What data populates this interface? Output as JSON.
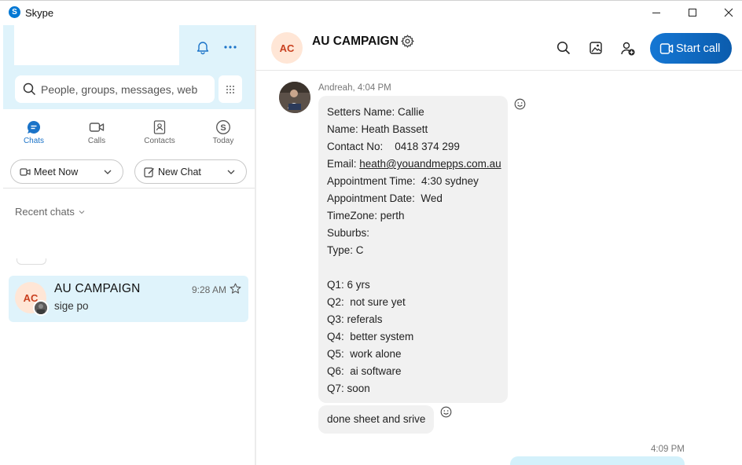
{
  "window": {
    "title": "Skype",
    "logo_letter": "S",
    "minimize_icon": "minimize-icon",
    "maximize_icon": "maximize-icon",
    "close_icon": "close-icon"
  },
  "sidebar": {
    "search": {
      "placeholder": "People, groups, messages, web"
    },
    "nav": [
      {
        "label": "Chats",
        "icon": "chat-bubble-icon",
        "active": true
      },
      {
        "label": "Calls",
        "icon": "video-camera-icon",
        "active": false
      },
      {
        "label": "Contacts",
        "icon": "contacts-book-icon",
        "active": false
      },
      {
        "label": "Today",
        "icon": "skype-today-icon",
        "active": false
      }
    ],
    "meet_now_label": "Meet Now",
    "new_chat_label": "New Chat",
    "recent_chats_label": "Recent chats",
    "chats": [
      {
        "initials": "AC",
        "name": "AU CAMPAIGN",
        "time": "9:28 AM",
        "preview": "sige po"
      }
    ]
  },
  "conversation": {
    "initials": "AC",
    "title": "AU CAMPAIGN",
    "start_call_label": "Start call",
    "messages": [
      {
        "sender_meta": "Andreah, 4:04 PM",
        "lines": [
          "Setters Name: Callie",
          "Name: Heath Bassett",
          "Contact No:    0418 374 299",
          "Email: ",
          "Appointment Time:  4:30 sydney",
          "Appointment Date:  Wed",
          "TimeZone: perth",
          "Suburbs:",
          "Type: C",
          "",
          "Q1: 6 yrs",
          "Q2:  not sure yet",
          "Q3: referals",
          "Q4:  better system",
          "Q5:  work alone",
          "Q6:  ai software",
          "Q7: soon"
        ],
        "email_link": "heath@youandmepps.com.au"
      },
      {
        "text": "done sheet and srive"
      }
    ],
    "outgoing_time": "4:09 PM"
  },
  "colors": {
    "accent": "#0078d4",
    "panel_bg": "#dff3fb",
    "avatar_bg": "#ffe6d6",
    "avatar_text": "#c9401f",
    "bubble_in": "#f1f1f1",
    "bubble_out": "#d4f1fb"
  }
}
